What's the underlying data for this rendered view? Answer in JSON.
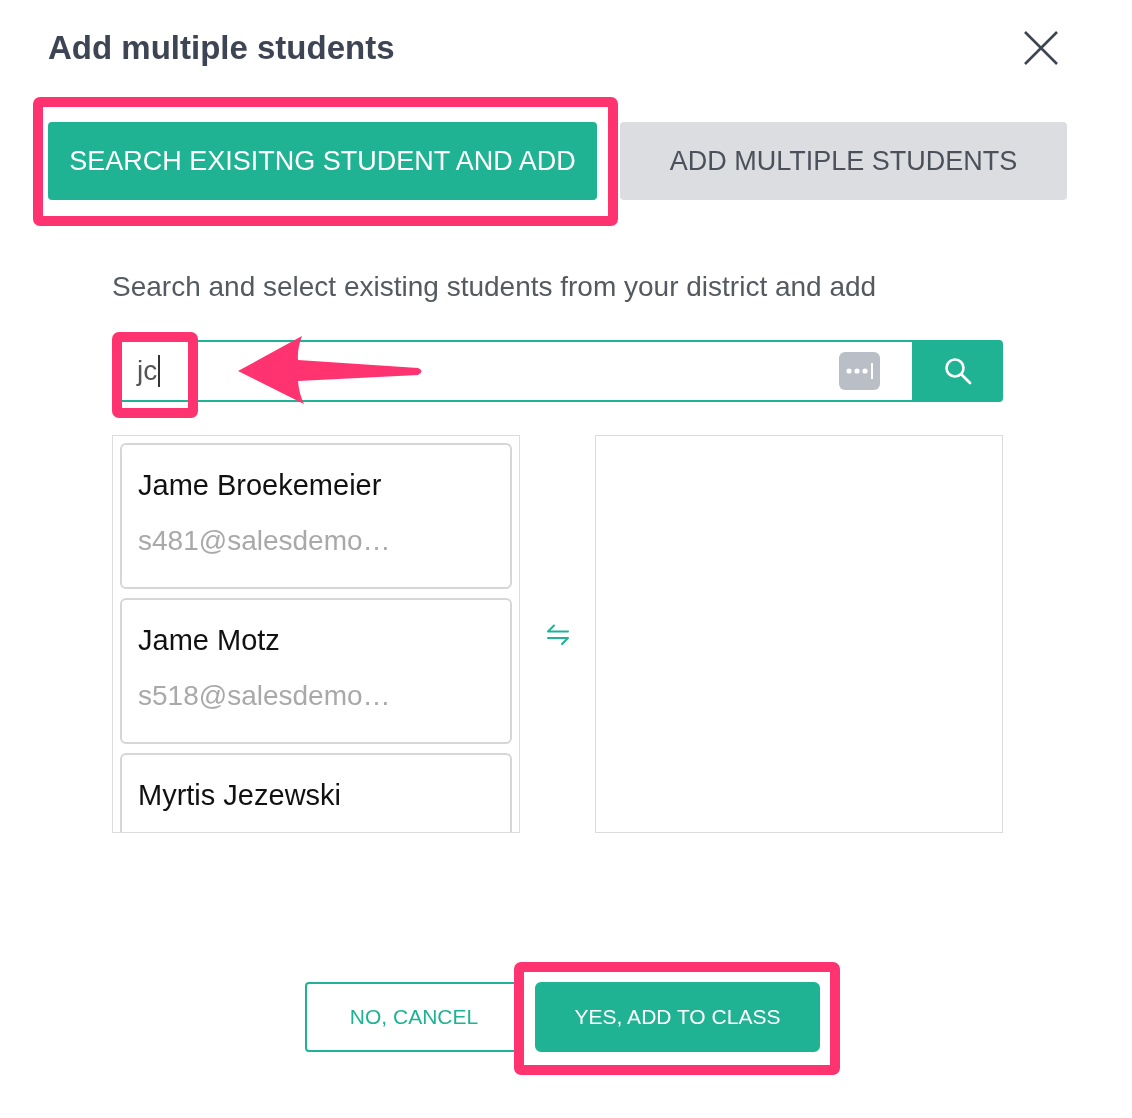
{
  "dialog": {
    "title": "Add multiple students"
  },
  "tabs": [
    {
      "label": "SEARCH EXISITNG STUDENT AND ADD",
      "selected": true,
      "highlighted": true
    },
    {
      "label": "ADD MULTIPLE STUDENTS",
      "selected": false,
      "highlighted": false
    }
  ],
  "instructions": "Search and select existing students from your district and add",
  "search": {
    "value": "jc",
    "highlighted": true,
    "arrow": true
  },
  "available_students": [
    {
      "name": "Jame Broekemeier",
      "email": "s481@salesdemo…"
    },
    {
      "name": "Jame Motz",
      "email": "s518@salesdemo…"
    },
    {
      "name": "Myrtis Jezewski"
    }
  ],
  "buttons": [
    {
      "label": "NO, CANCEL",
      "kind": "secondary",
      "highlighted": false
    },
    {
      "label": "YES, ADD TO CLASS",
      "kind": "primary",
      "highlighted": true
    }
  ]
}
